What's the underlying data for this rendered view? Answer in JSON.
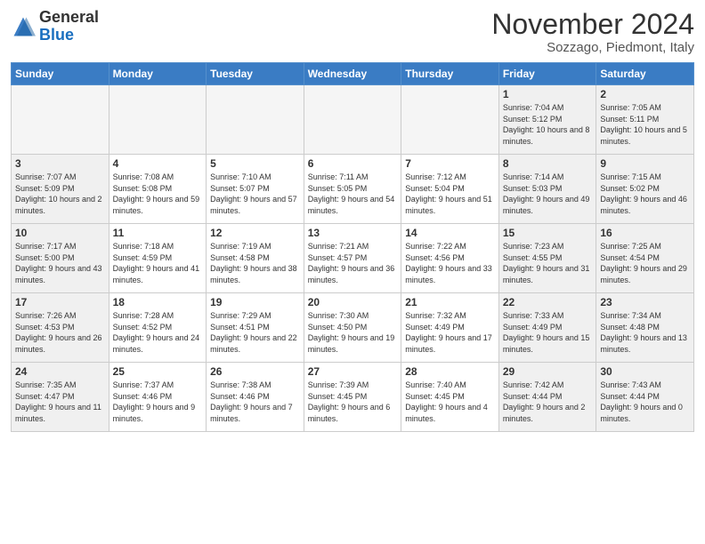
{
  "header": {
    "logo_general": "General",
    "logo_blue": "Blue",
    "month": "November 2024",
    "location": "Sozzago, Piedmont, Italy"
  },
  "weekdays": [
    "Sunday",
    "Monday",
    "Tuesday",
    "Wednesday",
    "Thursday",
    "Friday",
    "Saturday"
  ],
  "weeks": [
    [
      {
        "day": "",
        "info": "",
        "empty": true
      },
      {
        "day": "",
        "info": "",
        "empty": true
      },
      {
        "day": "",
        "info": "",
        "empty": true
      },
      {
        "day": "",
        "info": "",
        "empty": true
      },
      {
        "day": "",
        "info": "",
        "empty": true
      },
      {
        "day": "1",
        "info": "Sunrise: 7:04 AM\nSunset: 5:12 PM\nDaylight: 10 hours\nand 8 minutes.",
        "empty": false,
        "weekend": true
      },
      {
        "day": "2",
        "info": "Sunrise: 7:05 AM\nSunset: 5:11 PM\nDaylight: 10 hours\nand 5 minutes.",
        "empty": false,
        "weekend": true
      }
    ],
    [
      {
        "day": "3",
        "info": "Sunrise: 7:07 AM\nSunset: 5:09 PM\nDaylight: 10 hours\nand 2 minutes.",
        "empty": false,
        "weekend": true
      },
      {
        "day": "4",
        "info": "Sunrise: 7:08 AM\nSunset: 5:08 PM\nDaylight: 9 hours\nand 59 minutes.",
        "empty": false
      },
      {
        "day": "5",
        "info": "Sunrise: 7:10 AM\nSunset: 5:07 PM\nDaylight: 9 hours\nand 57 minutes.",
        "empty": false
      },
      {
        "day": "6",
        "info": "Sunrise: 7:11 AM\nSunset: 5:05 PM\nDaylight: 9 hours\nand 54 minutes.",
        "empty": false
      },
      {
        "day": "7",
        "info": "Sunrise: 7:12 AM\nSunset: 5:04 PM\nDaylight: 9 hours\nand 51 minutes.",
        "empty": false
      },
      {
        "day": "8",
        "info": "Sunrise: 7:14 AM\nSunset: 5:03 PM\nDaylight: 9 hours\nand 49 minutes.",
        "empty": false,
        "weekend": true
      },
      {
        "day": "9",
        "info": "Sunrise: 7:15 AM\nSunset: 5:02 PM\nDaylight: 9 hours\nand 46 minutes.",
        "empty": false,
        "weekend": true
      }
    ],
    [
      {
        "day": "10",
        "info": "Sunrise: 7:17 AM\nSunset: 5:00 PM\nDaylight: 9 hours\nand 43 minutes.",
        "empty": false,
        "weekend": true
      },
      {
        "day": "11",
        "info": "Sunrise: 7:18 AM\nSunset: 4:59 PM\nDaylight: 9 hours\nand 41 minutes.",
        "empty": false
      },
      {
        "day": "12",
        "info": "Sunrise: 7:19 AM\nSunset: 4:58 PM\nDaylight: 9 hours\nand 38 minutes.",
        "empty": false
      },
      {
        "day": "13",
        "info": "Sunrise: 7:21 AM\nSunset: 4:57 PM\nDaylight: 9 hours\nand 36 minutes.",
        "empty": false
      },
      {
        "day": "14",
        "info": "Sunrise: 7:22 AM\nSunset: 4:56 PM\nDaylight: 9 hours\nand 33 minutes.",
        "empty": false
      },
      {
        "day": "15",
        "info": "Sunrise: 7:23 AM\nSunset: 4:55 PM\nDaylight: 9 hours\nand 31 minutes.",
        "empty": false,
        "weekend": true
      },
      {
        "day": "16",
        "info": "Sunrise: 7:25 AM\nSunset: 4:54 PM\nDaylight: 9 hours\nand 29 minutes.",
        "empty": false,
        "weekend": true
      }
    ],
    [
      {
        "day": "17",
        "info": "Sunrise: 7:26 AM\nSunset: 4:53 PM\nDaylight: 9 hours\nand 26 minutes.",
        "empty": false,
        "weekend": true
      },
      {
        "day": "18",
        "info": "Sunrise: 7:28 AM\nSunset: 4:52 PM\nDaylight: 9 hours\nand 24 minutes.",
        "empty": false
      },
      {
        "day": "19",
        "info": "Sunrise: 7:29 AM\nSunset: 4:51 PM\nDaylight: 9 hours\nand 22 minutes.",
        "empty": false
      },
      {
        "day": "20",
        "info": "Sunrise: 7:30 AM\nSunset: 4:50 PM\nDaylight: 9 hours\nand 19 minutes.",
        "empty": false
      },
      {
        "day": "21",
        "info": "Sunrise: 7:32 AM\nSunset: 4:49 PM\nDaylight: 9 hours\nand 17 minutes.",
        "empty": false
      },
      {
        "day": "22",
        "info": "Sunrise: 7:33 AM\nSunset: 4:49 PM\nDaylight: 9 hours\nand 15 minutes.",
        "empty": false,
        "weekend": true
      },
      {
        "day": "23",
        "info": "Sunrise: 7:34 AM\nSunset: 4:48 PM\nDaylight: 9 hours\nand 13 minutes.",
        "empty": false,
        "weekend": true
      }
    ],
    [
      {
        "day": "24",
        "info": "Sunrise: 7:35 AM\nSunset: 4:47 PM\nDaylight: 9 hours\nand 11 minutes.",
        "empty": false,
        "weekend": true
      },
      {
        "day": "25",
        "info": "Sunrise: 7:37 AM\nSunset: 4:46 PM\nDaylight: 9 hours\nand 9 minutes.",
        "empty": false
      },
      {
        "day": "26",
        "info": "Sunrise: 7:38 AM\nSunset: 4:46 PM\nDaylight: 9 hours\nand 7 minutes.",
        "empty": false
      },
      {
        "day": "27",
        "info": "Sunrise: 7:39 AM\nSunset: 4:45 PM\nDaylight: 9 hours\nand 6 minutes.",
        "empty": false
      },
      {
        "day": "28",
        "info": "Sunrise: 7:40 AM\nSunset: 4:45 PM\nDaylight: 9 hours\nand 4 minutes.",
        "empty": false
      },
      {
        "day": "29",
        "info": "Sunrise: 7:42 AM\nSunset: 4:44 PM\nDaylight: 9 hours\nand 2 minutes.",
        "empty": false,
        "weekend": true
      },
      {
        "day": "30",
        "info": "Sunrise: 7:43 AM\nSunset: 4:44 PM\nDaylight: 9 hours\nand 0 minutes.",
        "empty": false,
        "weekend": true
      }
    ]
  ]
}
